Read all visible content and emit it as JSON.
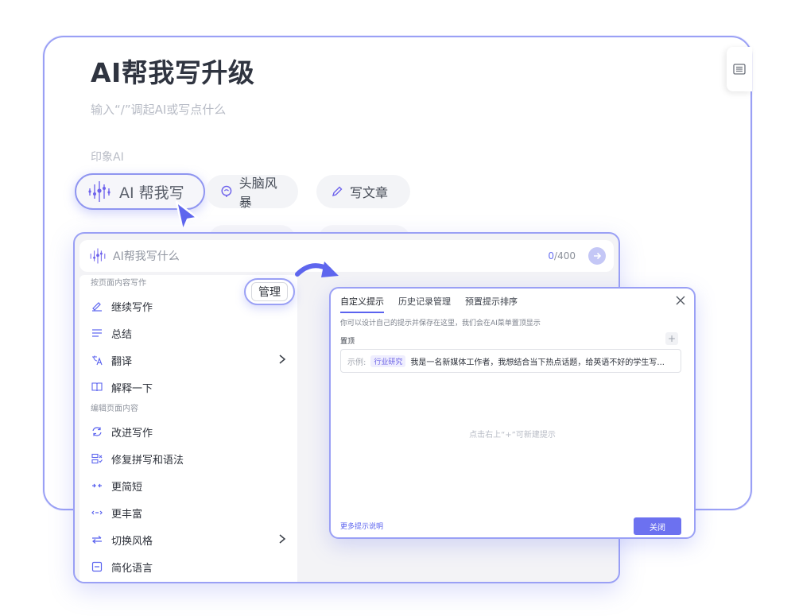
{
  "editor": {
    "title": "AI帮我写升级",
    "placeholder": "输入“/”调起AI或写点什么",
    "section_label": "印象AI",
    "side_icon": "list-icon"
  },
  "chips": {
    "ai_write": "AI 帮我写",
    "brainstorm": "头脑风暴",
    "write_article": "写文章"
  },
  "ai_panel": {
    "input_placeholder": "AI帮我写什么",
    "counter_current": "0",
    "counter_max": "/400"
  },
  "menu": {
    "group1": "按页面内容写作",
    "group2": "编辑页面内容",
    "items": [
      {
        "label": "继续写作",
        "icon": "pen-continue-icon"
      },
      {
        "label": "总结",
        "icon": "summary-list-icon"
      },
      {
        "label": "翻译",
        "icon": "translate-icon",
        "submenu": true
      },
      {
        "label": "解释一下",
        "icon": "book-icon"
      },
      {
        "label": "改进写作",
        "icon": "refresh-icon"
      },
      {
        "label": "修复拼写和语法",
        "icon": "spellcheck-icon"
      },
      {
        "label": "更简短",
        "icon": "shrink-icon"
      },
      {
        "label": "更丰富",
        "icon": "expand-icon"
      },
      {
        "label": "切换风格",
        "icon": "switch-icon",
        "submenu": true
      },
      {
        "label": "简化语言",
        "icon": "minus-box-icon"
      }
    ]
  },
  "manage_label": "管理",
  "dialog": {
    "tabs": [
      "自定义提示",
      "历史记录管理",
      "预置提示排序"
    ],
    "description": "你可以设计自己的提示并保存在这里，我们会在AI菜单置顶显示",
    "pinned_label": "置顶",
    "plus_label": "+",
    "example_label": "示例:",
    "example_tag": "行业研究",
    "example_text": "我是一名新媒体工作者，我想结合当下热点话题，给英语不好的学生写...",
    "empty_hint": "点击右上“+”可新建提示",
    "more_link": "更多提示说明",
    "close_label": "关闭"
  },
  "colors": {
    "accent": "#6c71f0",
    "border_highlight": "#9aa0f5"
  }
}
